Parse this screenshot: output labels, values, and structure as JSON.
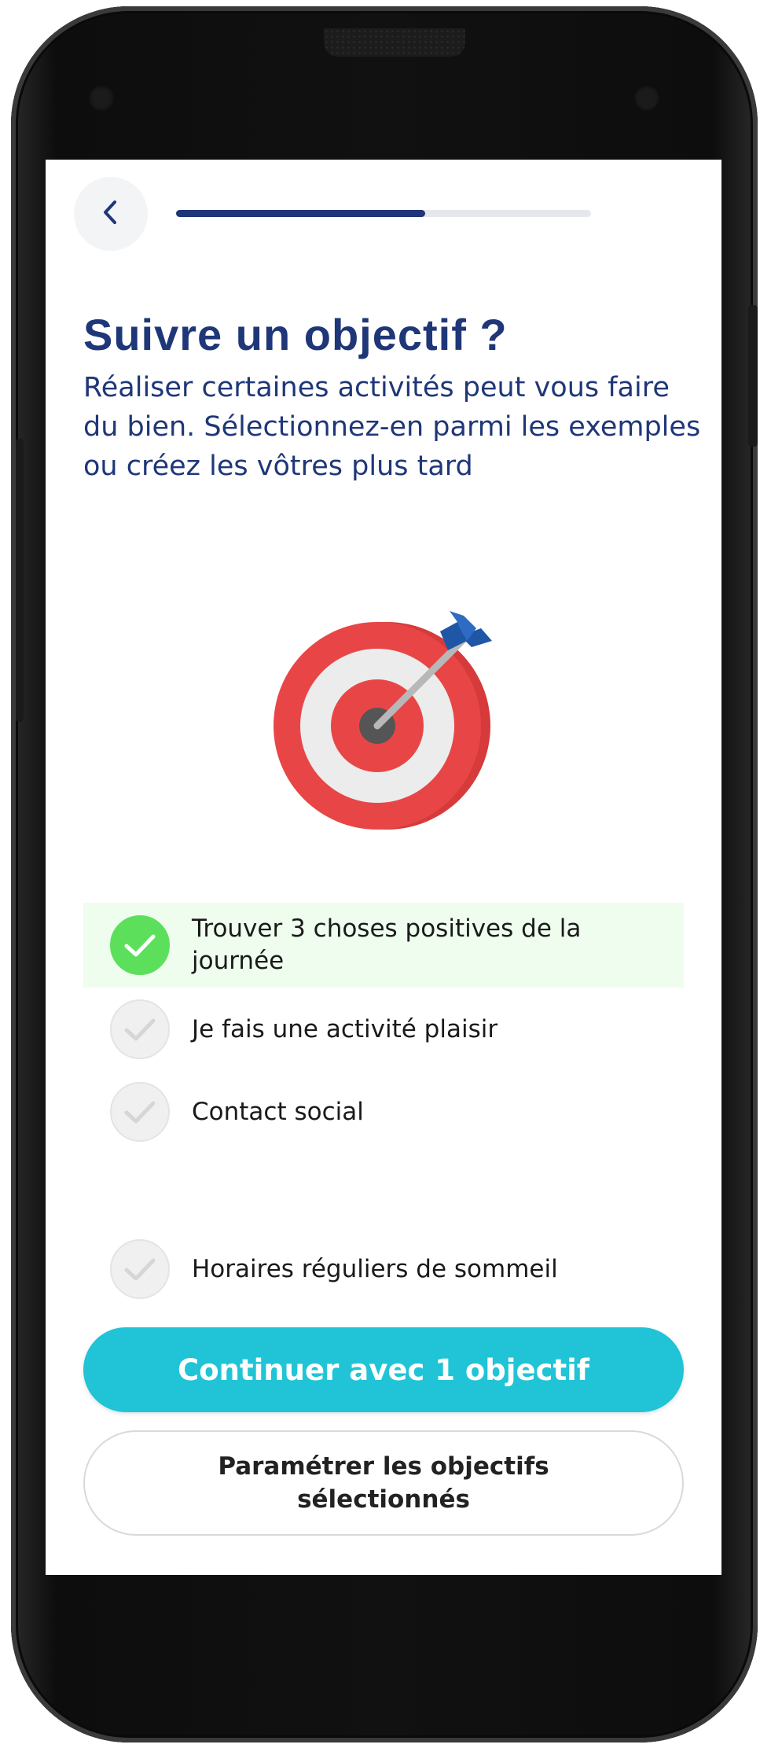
{
  "header": {
    "back_icon": "chevron-left-icon",
    "progress": 0.6
  },
  "title": "Suivre un objectif ?",
  "subtitle": "Réaliser certaines activités peut vous faire du bien. Sélectionnez-en parmi les exemples ou créez les vôtres plus tard",
  "illustration": "target-dart-icon",
  "goals": [
    {
      "label": "Trouver 3 choses positives de la journée",
      "selected": true
    },
    {
      "label": "Je fais une activité plaisir",
      "selected": false
    },
    {
      "label": "Contact social",
      "selected": false
    },
    {
      "label": "Horaires réguliers de sommeil",
      "selected": false
    }
  ],
  "buttons": {
    "continue_label": "Continuer avec 1 objectif",
    "configure_label": "Paramétrer les objectifs sélectionnés"
  },
  "colors": {
    "primary": "#20c4d6",
    "title": "#1f3778",
    "selected_bg": "#effdef",
    "check_selected": "#5ce05c"
  }
}
